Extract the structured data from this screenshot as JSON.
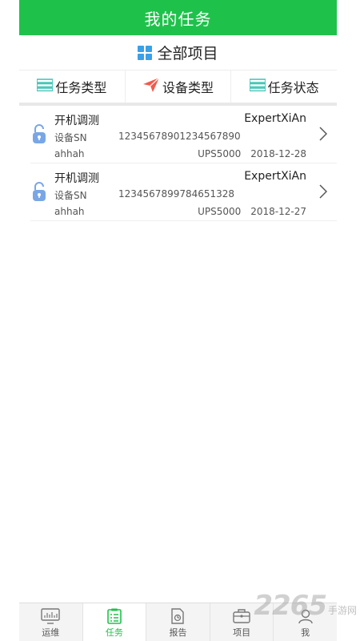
{
  "header": {
    "title": "我的任务"
  },
  "project_bar": {
    "label": "全部项目",
    "icon": "grid-icon",
    "icon_color": "#3aa0e8"
  },
  "filters": [
    {
      "label": "任务类型",
      "icon": "list-icon"
    },
    {
      "label": "设备类型",
      "icon": "paper-plane-icon"
    },
    {
      "label": "任务状态",
      "icon": "list-icon"
    }
  ],
  "tasks": [
    {
      "title": "开机调测",
      "owner": "ExpertXiAn",
      "sn_label": "设备SN",
      "sn": "12345678901234567890",
      "user": "ahhah",
      "model": "UPS5000",
      "date": "2018-12-28"
    },
    {
      "title": "开机调测",
      "owner": "ExpertXiAn",
      "sn_label": "设备SN",
      "sn": "1234567899784651328",
      "user": "ahhah",
      "model": "UPS5000",
      "date": "2018-12-27"
    }
  ],
  "tabbar": [
    {
      "label": "运维",
      "icon": "monitor-icon",
      "active": false
    },
    {
      "label": "任务",
      "icon": "task-list-icon",
      "active": true
    },
    {
      "label": "报告",
      "icon": "report-icon",
      "active": false
    },
    {
      "label": "项目",
      "icon": "toolbox-icon",
      "active": false
    },
    {
      "label": "我",
      "icon": "user-icon",
      "active": false
    }
  ],
  "watermark": {
    "number": "2265",
    "text": "手游网"
  },
  "colors": {
    "brand": "#1ec24a",
    "accent": "#3aa0e8",
    "lock": "#7aa6e6",
    "plane": "#f25a4a"
  }
}
